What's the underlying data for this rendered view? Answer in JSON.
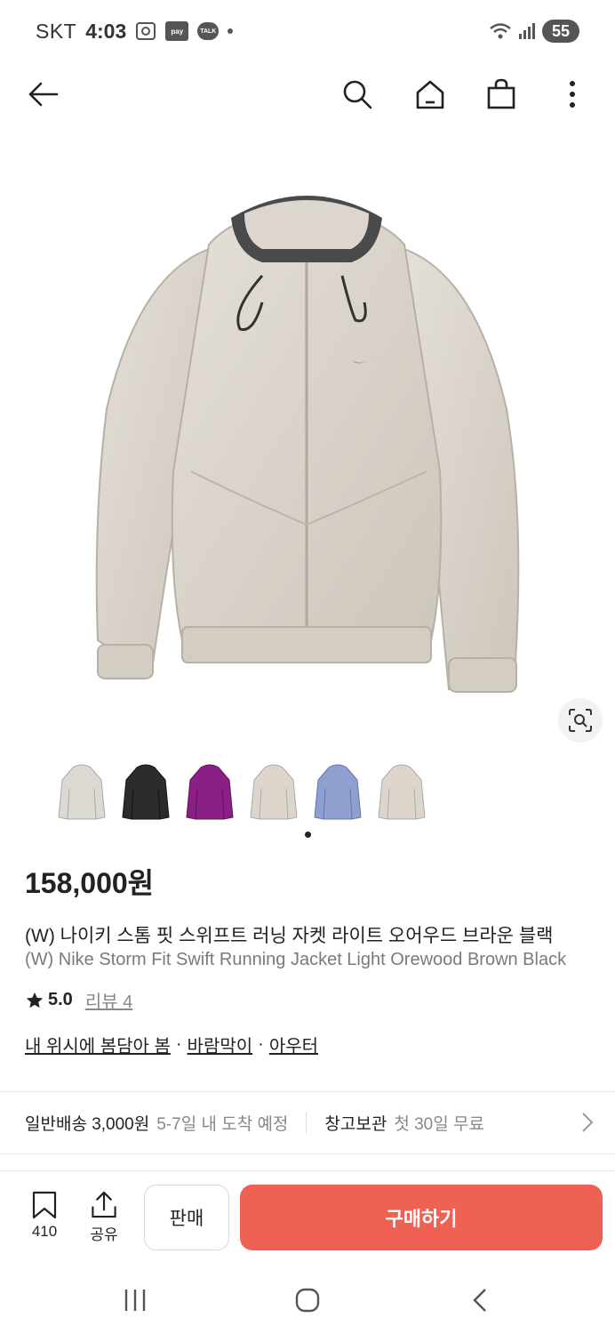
{
  "status_bar": {
    "carrier": "SKT",
    "time": "4:03",
    "pay_badge": "pay",
    "talk_badge": "TALK",
    "battery": "55"
  },
  "top_nav": {
    "icons": [
      "back-arrow-icon",
      "search-icon",
      "home-icon",
      "shopping-bag-icon",
      "more-vertical-icon"
    ]
  },
  "product": {
    "price": "158,000원",
    "title_kr": "(W) 나이키 스톰 핏 스위프트 러닝 자켓 라이트 오어우드 브라운 블랙",
    "title_en": "(W) Nike Storm Fit Swift Running Jacket Light Orewood Brown Black",
    "rating_value": "5.0",
    "review_link": "리뷰 4",
    "tags": [
      "내 위시에 봄담아 봄",
      "바람막이",
      "아우터"
    ],
    "tag_separator": "·",
    "thumbnail_colors": [
      "#dcd8d2",
      "#2b2b2d",
      "#8a1f86",
      "#ddd5cc",
      "#8e9fd0",
      "#ddd5cc"
    ],
    "thumbnail_count_selected": 4
  },
  "shipping": {
    "delivery_label": "일반배송 3,000원",
    "delivery_sub": "5-7일 내 도착 예정",
    "storage_label": "창고보관",
    "storage_sub": "첫 30일 무료"
  },
  "action_bar": {
    "wishlist_count": "410",
    "share_label": "공유",
    "sell_label": "판매",
    "buy_label": "구매하기",
    "buy_color": "#ef6253"
  }
}
